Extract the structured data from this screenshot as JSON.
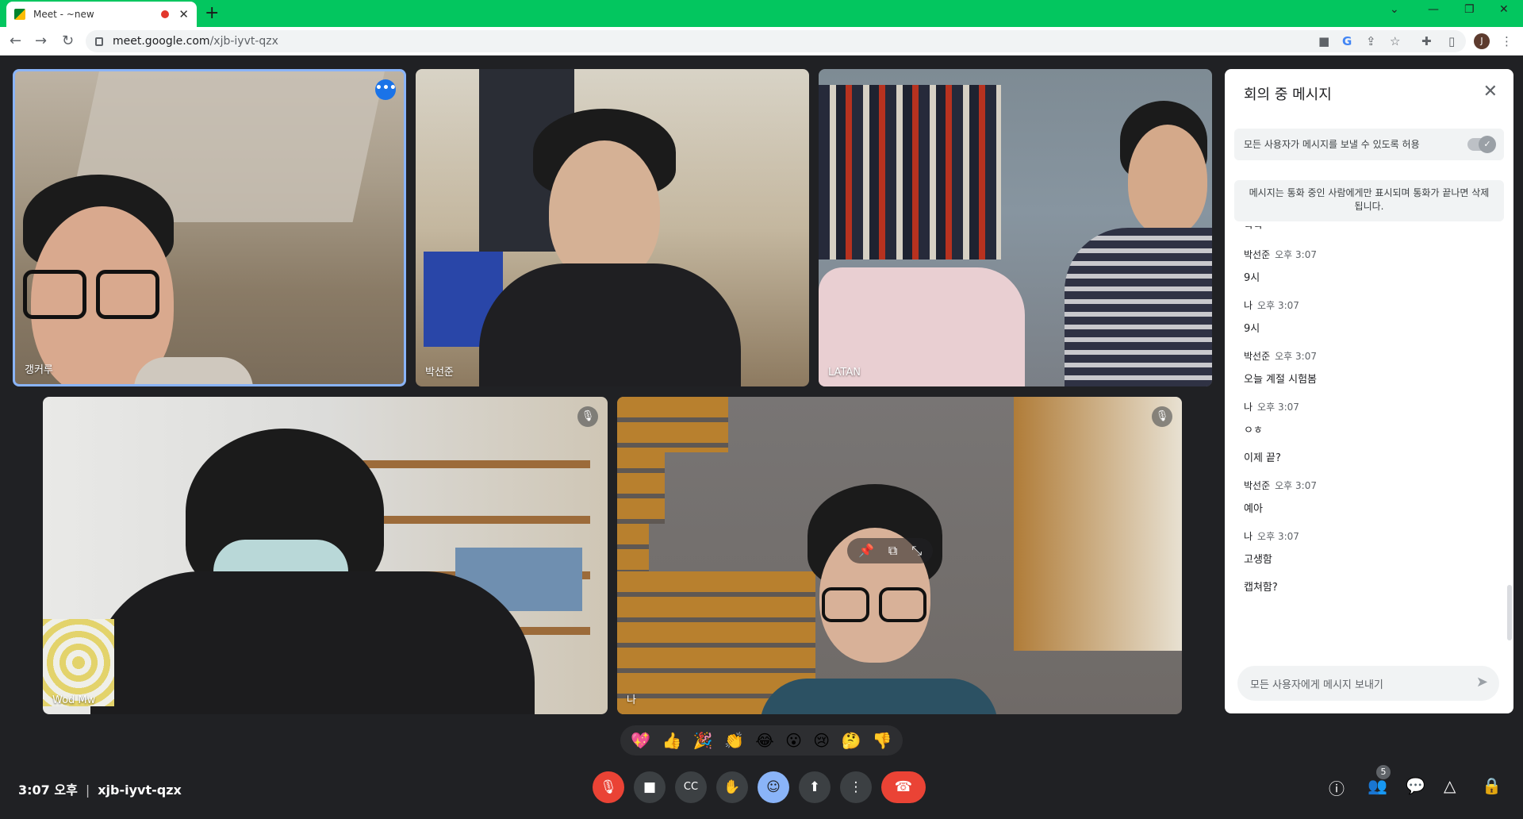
{
  "browser": {
    "tab_title": "Meet - ~new",
    "url_host": "meet.google.com",
    "url_path": "/xjb-iyvt-qzx",
    "profile_initial": "J"
  },
  "participants": [
    {
      "name": "갱커루",
      "active": true
    },
    {
      "name": "박선준"
    },
    {
      "name": "LATAN"
    },
    {
      "name": "Wod Mw",
      "muted": true
    },
    {
      "name": "나",
      "muted": true
    }
  ],
  "reactions": [
    "💖",
    "👍",
    "🎉",
    "👏",
    "😂",
    "😮",
    "😢",
    "🤔",
    "👎"
  ],
  "bottom_bar": {
    "time": "3:07 오후",
    "meeting_code": "xjb-iyvt-qzx",
    "participant_count": "5"
  },
  "chat": {
    "title": "회의 중 메시지",
    "allow_label": "모든 사용자가 메시지를 보낼 수 있도록 허용",
    "notice": "메시지는 통화 중인 사람에게만 표시되며 통화가 끝나면 삭제됩니다.",
    "cut_text": "ㅋㅋ",
    "messages": [
      {
        "sender": "박선준",
        "time": "오후 3:07",
        "lines": [
          "9시"
        ]
      },
      {
        "sender": "나",
        "time": "오후 3:07",
        "lines": [
          "9시"
        ]
      },
      {
        "sender": "박선준",
        "time": "오후 3:07",
        "lines": [
          "오늘 계절 시험봄"
        ]
      },
      {
        "sender": "나",
        "time": "오후 3:07",
        "lines": [
          "ㅇㅎ",
          "이제 끝?"
        ]
      },
      {
        "sender": "박선준",
        "time": "오후 3:07",
        "lines": [
          "예아"
        ]
      },
      {
        "sender": "나",
        "time": "오후 3:07",
        "lines": [
          "고생함",
          "캡쳐함?"
        ]
      }
    ],
    "input_placeholder": "모든 사용자에게 메시지 보내기"
  },
  "colors": {
    "tabbar": "#03c65f",
    "accent": "#8ab4f8",
    "end_call": "#ea4335",
    "background": "#202124"
  }
}
